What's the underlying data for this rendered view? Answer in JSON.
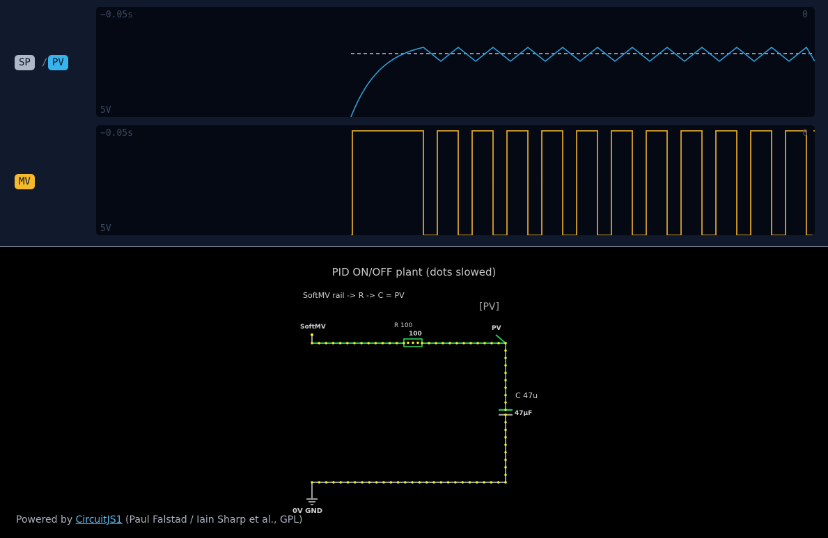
{
  "scope_pv": {
    "time_start": "−0.05s",
    "time_end": "0",
    "voltage_label": "5V",
    "pv_color": "#2f9fd8",
    "sp_color": "#8b96aa"
  },
  "scope_mv": {
    "time_start": "−0.05s",
    "time_end": "0",
    "voltage_label": "5V",
    "mv_color": "#d9a22c"
  },
  "badges": {
    "sp": "SP",
    "separator": "/",
    "pv": "PV",
    "mv": "MV"
  },
  "circuit": {
    "title": "PID ON/OFF plant (dots slowed)",
    "subtitle": "SoftMV rail -> R -> C = PV",
    "pv_node_label": "[PV]",
    "softmv_label": "SoftMV",
    "resistor_name": "R 100",
    "resistor_value": "100",
    "pv_label": "PV",
    "capacitor_name": "C 47u",
    "capacitor_value": "47µF",
    "ground_label": "0V GND",
    "wire_color": "#22c45a",
    "current_dot_color": "#f2f21e",
    "ground_wire_color": "#9c9c9c"
  },
  "footer": {
    "prefix": "Powered by ",
    "link_text": "CircuitJS1",
    "suffix": " (Paul Falstad / Iain Sharp et al., GPL)"
  }
}
